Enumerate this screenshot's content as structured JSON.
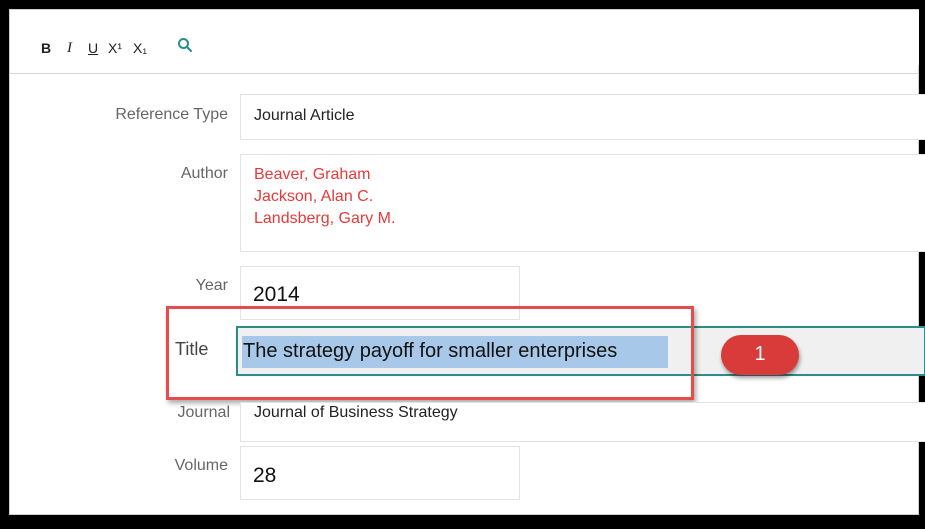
{
  "toolbar": {
    "bold": "B",
    "italic": "I",
    "underline": "U",
    "superscript": "X¹",
    "subscript": "X₁",
    "search_icon": "search-icon"
  },
  "fields": {
    "reference_type": {
      "label": "Reference Type",
      "value": "Journal Article"
    },
    "author": {
      "label": "Author",
      "values": [
        "Beaver, Graham",
        "Jackson, Alan C.",
        "Landsberg, Gary M."
      ]
    },
    "year": {
      "label": "Year",
      "value": "2014"
    },
    "title": {
      "label": "Title",
      "value": "The strategy payoff for smaller enterprises"
    },
    "journal": {
      "label": "Journal",
      "value": "Journal of Business Strategy"
    },
    "volume": {
      "label": "Volume",
      "value": "28"
    }
  },
  "callout": {
    "number": "1"
  },
  "colors": {
    "author_red": "#e53a3a",
    "highlight_border": "#e74c4c",
    "active_border": "#2e8b86",
    "selection": "#a7c8e8",
    "callout_red": "#d93a3a"
  }
}
